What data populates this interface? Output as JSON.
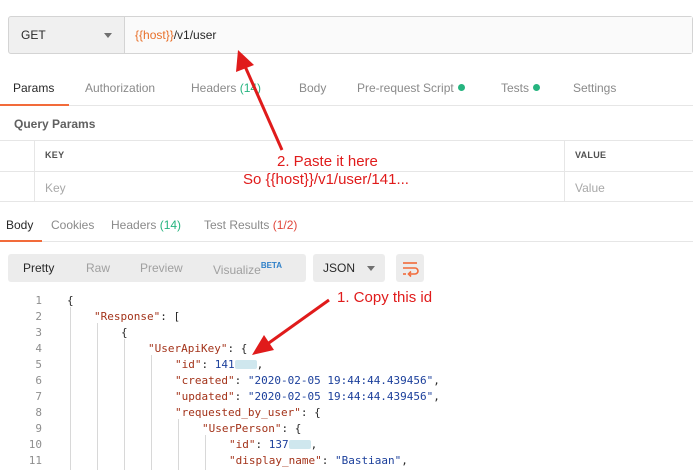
{
  "request": {
    "method": "GET",
    "url_var": "{{host}}",
    "url_path": "/v1/user"
  },
  "request_tabs": [
    {
      "label": "Params"
    },
    {
      "label": "Authorization"
    },
    {
      "label": "Headers",
      "count": "(14)"
    },
    {
      "label": "Body"
    },
    {
      "label": "Pre-request Script"
    },
    {
      "label": "Tests"
    },
    {
      "label": "Settings"
    }
  ],
  "query_params": {
    "title": "Query Params",
    "key_header": "KEY",
    "value_header": "VALUE",
    "key_placeholder": "Key",
    "value_placeholder": "Value"
  },
  "response_tabs": {
    "body": "Body",
    "cookies": "Cookies",
    "headers": "Headers",
    "headers_count": "(14)",
    "tests": "Test Results",
    "tests_count": "(1/2)"
  },
  "view_modes": {
    "pretty": "Pretty",
    "raw": "Raw",
    "preview": "Preview",
    "visualize": "Visualize",
    "visualize_badge": "BETA"
  },
  "format": "JSON",
  "code_lines": {
    "n1": "1",
    "n2": "2",
    "n3": "3",
    "n4": "4",
    "n5": "5",
    "n6": "6",
    "n7": "7",
    "n8": "8",
    "n9": "9",
    "n10": "10",
    "n11": "11",
    "l1": "{",
    "l2_key": "\"Response\"",
    "l2_rest": ": [",
    "l3": "{",
    "l4_key": "\"UserApiKey\"",
    "l4_rest": ": {",
    "l5_key": "\"id\"",
    "l5_val": "141",
    "l6_key": "\"created\"",
    "l6_val": "\"2020-02-05 19:44:44.439456\"",
    "l7_key": "\"updated\"",
    "l7_val": "\"2020-02-05 19:44:44.439456\"",
    "l8_key": "\"requested_by_user\"",
    "l8_rest": ": {",
    "l9_key": "\"UserPerson\"",
    "l9_rest": ": {",
    "l10_key": "\"id\"",
    "l10_val": "137",
    "l11_key": "\"display_name\"",
    "l11_val": "\"Bastiaan\""
  },
  "annotations": {
    "paste_line1": "2. Paste it here",
    "paste_line2": "So {{host}}/v1/user/141...",
    "copy": "1. Copy this id",
    "color": "#e01b1b"
  },
  "colors": {
    "accent": "#f26b3a",
    "green": "#26b47f",
    "red": "#e0463b",
    "variable": "#e8702a"
  }
}
